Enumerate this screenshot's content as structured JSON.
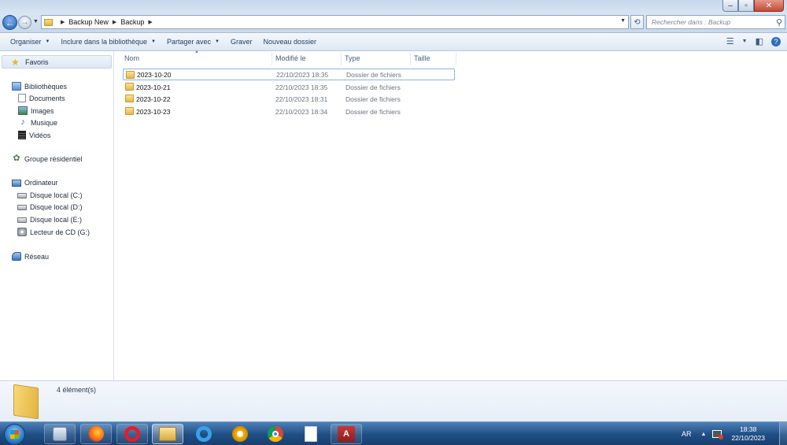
{
  "window": {
    "breadcrumb": [
      "Backup New",
      "Backup"
    ],
    "search_placeholder": "Rechercher dans : Backup"
  },
  "toolbar": {
    "organize": "Organiser",
    "include_library": "Inclure dans la bibliothèque",
    "share_with": "Partager avec",
    "burn": "Graver",
    "new_folder": "Nouveau dossier"
  },
  "navpane": {
    "favorites": "Favoris",
    "libraries": "Bibliothèques",
    "documents": "Documents",
    "images": "Images",
    "music": "Musique",
    "videos": "Vidéos",
    "homegroup": "Groupe résidentiel",
    "computer": "Ordinateur",
    "drive_c": "Disque local (C:)",
    "drive_d": "Disque local (D:)",
    "drive_e": "Disque local (E:)",
    "cd_drive": "Lecteur de CD (G:)",
    "network": "Réseau"
  },
  "columns": {
    "name": "Nom",
    "modified": "Modifié le",
    "type": "Type",
    "size": "Taille"
  },
  "files": [
    {
      "name": "2023-10-20",
      "modified": "22/10/2023 18:35",
      "type": "Dossier de fichiers",
      "size": ""
    },
    {
      "name": "2023-10-21",
      "modified": "22/10/2023 18:35",
      "type": "Dossier de fichiers",
      "size": ""
    },
    {
      "name": "2023-10-22",
      "modified": "22/10/2023 18:31",
      "type": "Dossier de fichiers",
      "size": ""
    },
    {
      "name": "2023-10-23",
      "modified": "22/10/2023 18:34",
      "type": "Dossier de fichiers",
      "size": ""
    }
  ],
  "details": {
    "item_count": "4 élément(s)"
  },
  "taskbar": {
    "apps": [
      "windows-media-player",
      "firefox",
      "opera",
      "windows-explorer",
      "internet-explorer",
      "avast",
      "chrome",
      "notepad",
      "microsoft-access"
    ],
    "language": "AR",
    "time": "18:38",
    "date": "22/10/2023"
  },
  "colors": {
    "accent": "#1f5fb5",
    "taskbar": "#1f4e84",
    "folder": "#e4b84a",
    "close_button": "#c9472f"
  }
}
